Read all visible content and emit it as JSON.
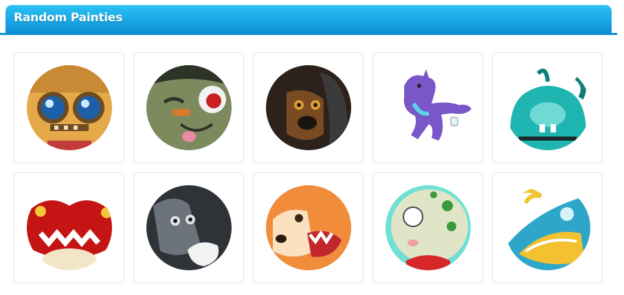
{
  "section": {
    "title": "Random Painties",
    "accent_color": "#1aa6e6"
  },
  "painties": [
    {
      "icon": "robot-avatar-icon",
      "type": "circle",
      "bg": "#e6a94a"
    },
    {
      "icon": "zombie-dog-avatar-icon",
      "type": "circle",
      "bg": "#7d8a5e"
    },
    {
      "icon": "black-dog-avatar-icon",
      "type": "circle",
      "bg": "#2d221b"
    },
    {
      "icon": "purple-dragon-avatar-icon",
      "type": "free",
      "bg": "#7a57c8"
    },
    {
      "icon": "teal-creature-avatar-icon",
      "type": "circle",
      "bg": "#1fb5b0"
    },
    {
      "icon": "red-creature-avatar-icon",
      "type": "circle",
      "bg": "#c41414"
    },
    {
      "icon": "gray-wolf-avatar-icon",
      "type": "circle",
      "bg": "#5a5f66"
    },
    {
      "icon": "orange-fox-avatar-icon",
      "type": "circle",
      "bg": "#f08c3a"
    },
    {
      "icon": "green-dino-avatar-icon",
      "type": "circle",
      "bg": "#dfe5c6"
    },
    {
      "icon": "blue-gold-creature-avatar-icon",
      "type": "circle",
      "bg": "#2ea6c9"
    }
  ]
}
